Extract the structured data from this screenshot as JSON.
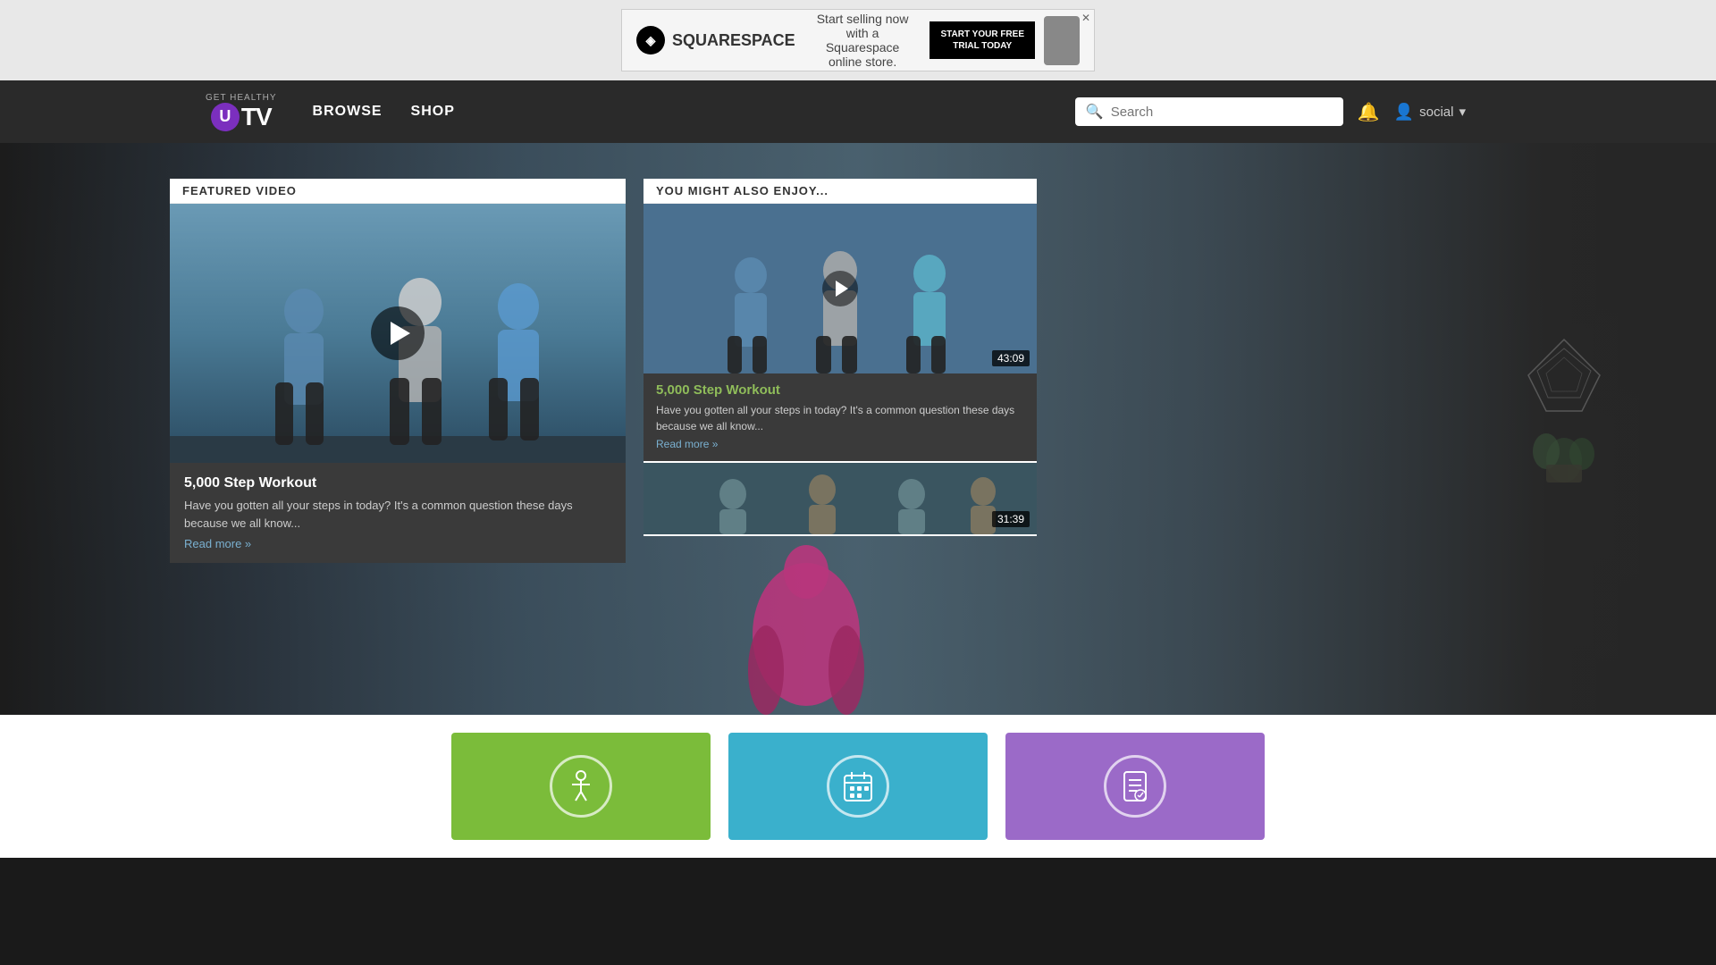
{
  "ad": {
    "brand": "SQUARESPACE",
    "tagline": "Start selling now with a Squarespace online store.",
    "cta": "START YOUR FREE\nTRIAL TODAY",
    "close_label": "✕"
  },
  "nav": {
    "logo_top": "GET HEALTHY",
    "logo_u": "U",
    "logo_tv": "TV",
    "browse": "BROWSE",
    "shop": "SHOP",
    "search_placeholder": "Search",
    "user_label": "social"
  },
  "featured": {
    "section_label": "FEATURED VIDEO",
    "title": "5,000 Step Workout",
    "description": "Have you gotten all your steps in today? It's a common question these days because we all know...",
    "read_more": "Read more »"
  },
  "enjoy": {
    "section_label": "YOU MIGHT ALSO ENJOY...",
    "items": [
      {
        "title": "5,000 Step Workout",
        "description": "Have you gotten all your steps in today? It's a common question these days because we all know...",
        "read_more": "Read more »",
        "duration": "43:09"
      },
      {
        "duration": "31:39"
      }
    ]
  },
  "categories": [
    {
      "id": "workouts",
      "icon": "🏃",
      "color": "#7bbc3a"
    },
    {
      "id": "schedule",
      "icon": "📅",
      "color": "#3ab0cc"
    },
    {
      "id": "plan",
      "icon": "📋",
      "color": "#9b6ac8"
    }
  ]
}
